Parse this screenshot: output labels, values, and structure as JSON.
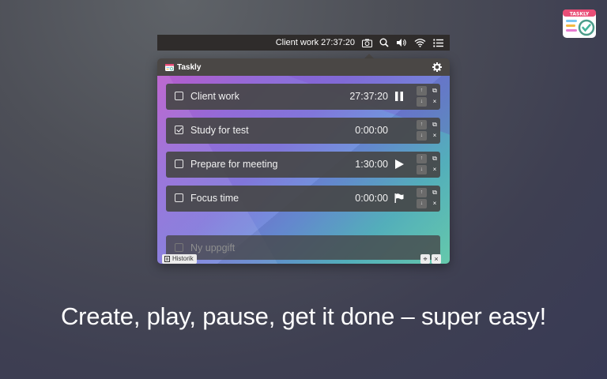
{
  "logo": {
    "text": "TASKLY",
    "icon": "taskly-logo-icon"
  },
  "menubar": {
    "title": "Client work 27:37:20",
    "icons": [
      "camera-icon",
      "search-icon",
      "volume-icon",
      "wifi-icon",
      "list-icon"
    ]
  },
  "popover": {
    "app_name": "Taskly",
    "tasks": [
      {
        "name": "Client work",
        "time": "27:37:20",
        "checked": false,
        "action": "pause-icon"
      },
      {
        "name": "Study for test",
        "time": "0:00:00",
        "checked": true,
        "action": ""
      },
      {
        "name": "Prepare for meeting",
        "time": "1:30:00",
        "checked": false,
        "action": "play-icon"
      },
      {
        "name": "Focus time",
        "time": "0:00:00",
        "checked": false,
        "action": "flag-icon"
      }
    ],
    "order_up": "↑",
    "order_down": "↓",
    "copy_glyph": "⧉",
    "delete_glyph": "×",
    "new_task_placeholder": "Ny uppgift",
    "history_label": "Historik",
    "pin_glyph": "⌖",
    "close_glyph": "×"
  },
  "caption": "Create, play, pause, get it done – super easy!",
  "colors": {
    "accent_purple": "#b453c9",
    "accent_teal": "#6bd5b6",
    "row_bg": "#464648"
  }
}
